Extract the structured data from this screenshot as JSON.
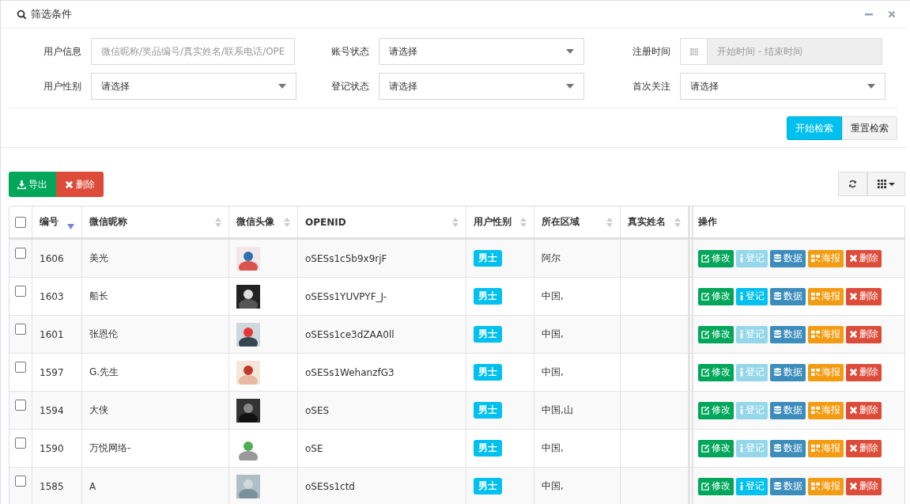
{
  "panel": {
    "title": "筛选条件"
  },
  "filters": [
    {
      "label": "用户信息",
      "kind": "text",
      "placeholder": "微信昵称/奖品编号/真实姓名/联系电话/OPE"
    },
    {
      "label": "账号状态",
      "kind": "select",
      "value": "请选择"
    },
    {
      "label": "注册时间",
      "kind": "date",
      "placeholder": "开始时间 - 结束时间"
    },
    {
      "label": "用户性别",
      "kind": "select",
      "value": "请选择"
    },
    {
      "label": "登记状态",
      "kind": "select",
      "value": "请选择"
    },
    {
      "label": "首次关注",
      "kind": "select",
      "value": "请选择"
    }
  ],
  "search_buttons": {
    "start": "开始检索",
    "reset": "重置检索"
  },
  "toolbar": {
    "export": "导出",
    "delete": "删除"
  },
  "table": {
    "all_checked": false,
    "columns": [
      {
        "label": "编号",
        "sortable": true,
        "sorted": true
      },
      {
        "label": "微信昵称",
        "sortable": true,
        "sorted": false
      },
      {
        "label": "微信头像",
        "sortable": true,
        "sorted": false
      },
      {
        "label": "OPENID",
        "sortable": true,
        "sorted": false
      },
      {
        "label": "用户性别",
        "sortable": true,
        "sorted": false
      },
      {
        "label": "所在区域",
        "sortable": true,
        "sorted": false
      },
      {
        "label": "真实姓名",
        "sortable": true,
        "sorted": false
      },
      {
        "label": "操作",
        "sortable": false
      }
    ],
    "rows": [
      {
        "checked": false,
        "id": "1606",
        "nickname": "美光",
        "openid": "oSESs1c5b9x9rjF",
        "gender": "男士",
        "region": "阿尔",
        "registered": false,
        "actions": [
          {
            "kind": "edit",
            "label": "修改"
          },
          {
            "kind": "register",
            "label": "登记"
          },
          {
            "kind": "data",
            "label": "数据"
          },
          {
            "kind": "poster",
            "label": "海报"
          },
          {
            "kind": "delete",
            "label": "删除"
          }
        ]
      },
      {
        "checked": false,
        "id": "1603",
        "nickname": "船长",
        "openid": "oSESs1YUVPYF_J-",
        "gender": "男士",
        "region": "中国,",
        "registered": true,
        "actions": [
          {
            "kind": "edit",
            "label": "修改"
          },
          {
            "kind": "register",
            "label": "登记"
          },
          {
            "kind": "data",
            "label": "数据"
          },
          {
            "kind": "poster",
            "label": "海报"
          },
          {
            "kind": "delete",
            "label": "删除"
          }
        ]
      },
      {
        "checked": false,
        "id": "1601",
        "nickname": "张恩伦",
        "openid": "oSESs1ce3dZAA0ll",
        "gender": "男士",
        "region": "中国,",
        "registered": false,
        "actions": [
          {
            "kind": "edit",
            "label": "修改"
          },
          {
            "kind": "register",
            "label": "登记"
          },
          {
            "kind": "data",
            "label": "数据"
          },
          {
            "kind": "poster",
            "label": "海报"
          },
          {
            "kind": "delete",
            "label": "删除"
          }
        ]
      },
      {
        "checked": false,
        "id": "1597",
        "nickname": "G.先生",
        "openid": "oSESs1WehanzfG3",
        "gender": "男士",
        "region": "中国,",
        "registered": false,
        "actions": [
          {
            "kind": "edit",
            "label": "修改"
          },
          {
            "kind": "register",
            "label": "登记"
          },
          {
            "kind": "data",
            "label": "数据"
          },
          {
            "kind": "poster",
            "label": "海报"
          },
          {
            "kind": "delete",
            "label": "删除"
          }
        ]
      },
      {
        "checked": false,
        "id": "1594",
        "nickname": "大侠",
        "openid": "oSES",
        "gender": "男士",
        "region": "中国,山",
        "registered": false,
        "actions": [
          {
            "kind": "edit",
            "label": "修改"
          },
          {
            "kind": "register",
            "label": "登记"
          },
          {
            "kind": "data",
            "label": "数据"
          },
          {
            "kind": "poster",
            "label": "海报"
          },
          {
            "kind": "delete",
            "label": "删除"
          }
        ]
      },
      {
        "checked": false,
        "id": "1590",
        "nickname": "万悦网络-",
        "openid": "oSE",
        "gender": "男士",
        "region": "中国,",
        "registered": false,
        "actions": [
          {
            "kind": "edit",
            "label": "修改"
          },
          {
            "kind": "register",
            "label": "登记"
          },
          {
            "kind": "data",
            "label": "数据"
          },
          {
            "kind": "poster",
            "label": "海报"
          },
          {
            "kind": "delete",
            "label": "删除"
          }
        ]
      },
      {
        "checked": false,
        "id": "1585",
        "nickname": "A",
        "openid": "oSESs1ctd",
        "gender": "男士",
        "region": "中国,",
        "registered": true,
        "actions": [
          {
            "kind": "edit",
            "label": "修改"
          },
          {
            "kind": "register",
            "label": "登记"
          },
          {
            "kind": "data",
            "label": "数据"
          },
          {
            "kind": "poster",
            "label": "海报"
          },
          {
            "kind": "delete",
            "label": "删除"
          }
        ]
      }
    ]
  }
}
